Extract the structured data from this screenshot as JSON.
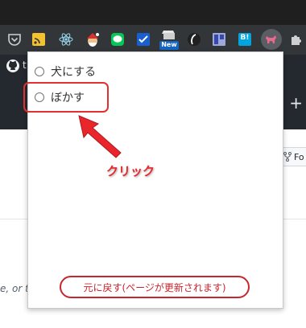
{
  "browser": {
    "extensions": [
      {
        "name": "pocket-icon"
      },
      {
        "name": "rss-icon"
      },
      {
        "name": "react-devtools-icon"
      },
      {
        "name": "santa-icon"
      },
      {
        "name": "line-icon"
      },
      {
        "name": "checkmark-icon"
      },
      {
        "name": "new-extension-icon",
        "badge": "New"
      },
      {
        "name": "leaf-icon"
      },
      {
        "name": "bookmark-extension-icon"
      },
      {
        "name": "hatena-bookmark-icon",
        "label": "B!"
      },
      {
        "name": "dog-extension-icon"
      },
      {
        "name": "puzzle-icon"
      }
    ]
  },
  "github": {
    "tab_prefix": "t",
    "fork_label": "Fo",
    "side_text": "e, or t",
    "plus": "+"
  },
  "popup": {
    "options": [
      "犬にする",
      "ぼかす"
    ],
    "restore_button": "元に戻す(ページが更新されます)"
  },
  "annotation": {
    "label": "クリック",
    "color": "#e8262b"
  }
}
